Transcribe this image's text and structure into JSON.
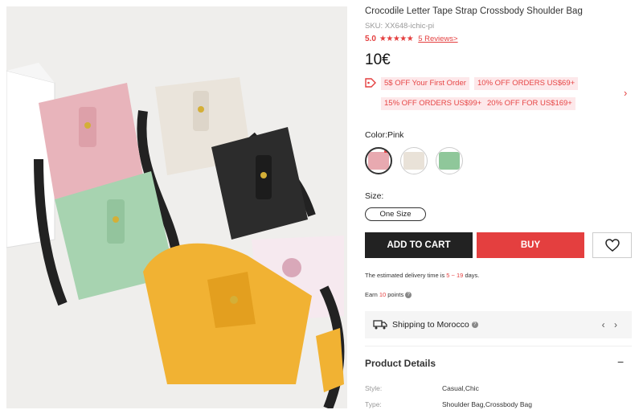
{
  "product": {
    "title": "Crocodile Letter Tape Strap Crossbody Shoulder Bag",
    "sku": "SKU: XX648-ichic-pi",
    "rating": "5.0",
    "stars": "★★★★★",
    "reviews": "5 Reviews>",
    "price": "10€"
  },
  "coupons": [
    "5$ OFF Your First Order",
    "10% OFF ORDERS US$69+",
    "15% OFF ORDERS US$99+",
    "20% OFF FOR US$169+"
  ],
  "coupon_arrow": "›",
  "color": {
    "label": "Color:Pink",
    "swatches": [
      {
        "name": "Pink",
        "hex": "#e8a9b0",
        "selected": true
      },
      {
        "name": "White",
        "hex": "#e9e2d8",
        "selected": false
      },
      {
        "name": "Green",
        "hex": "#8fc79a",
        "selected": false
      }
    ]
  },
  "size": {
    "label": "Size:",
    "options": [
      "One Size"
    ]
  },
  "actions": {
    "add_to_cart": "ADD TO CART",
    "buy": "BUY"
  },
  "delivery": {
    "prefix": "The estimated delivery time is ",
    "range": "5 ~ 19",
    "suffix": " days."
  },
  "points": {
    "prefix": "Earn ",
    "value": "10",
    "suffix": " points"
  },
  "shipping": {
    "label": "Shipping to Morocco",
    "arrows": "‹ ›"
  },
  "details": {
    "title": "Product Details",
    "toggle": "−",
    "specs": [
      {
        "label": "Style:",
        "value": "Casual,Chic"
      },
      {
        "label": "Type:",
        "value": "Shoulder Bag,Crossbody Bag"
      }
    ]
  },
  "colors": {
    "accent": "#e43f3f",
    "dark_button": "#222222",
    "coupon_bg": "#fde8ea"
  }
}
